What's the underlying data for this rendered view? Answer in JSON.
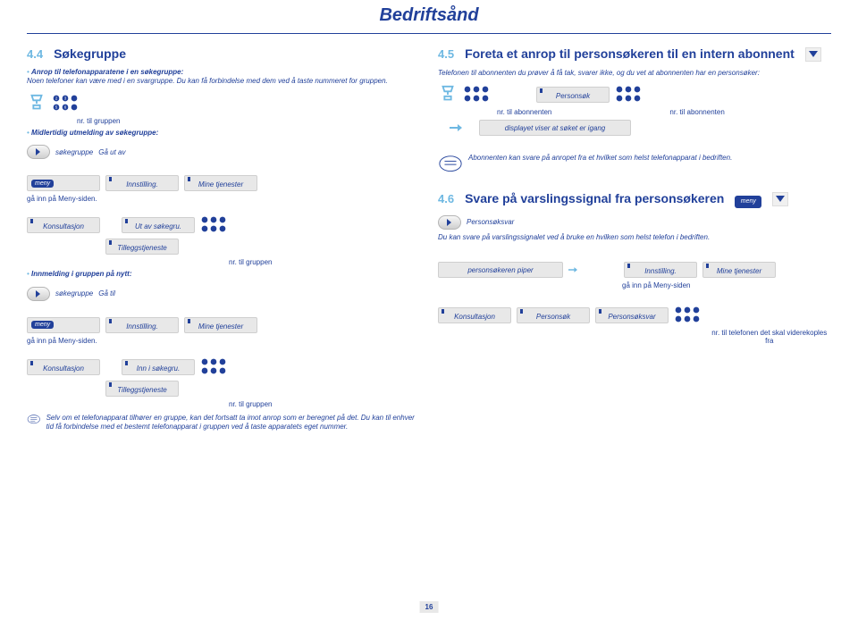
{
  "page": {
    "title": "Bedriftsånd",
    "page_number": "16"
  },
  "left": {
    "s44": {
      "num": "4.4",
      "title": "Søkegruppe",
      "intro_1": "Anrop til telefonapparatene i en søkegruppe:",
      "intro_2": "Noen telefoner kan være med i en svargruppe. Du kan få forbindelse med dem ved å taste nummeret for gruppen.",
      "label_nr_gruppen": "nr. til gruppen",
      "sub1": "Midlertidig utmelding av søkegruppe:",
      "lcd_sokegruppe": "søkegruppe",
      "lcd_ga_ut_av": "Gå ut av",
      "meny_label": "meny",
      "lcd_innstilling": "Innstilling.",
      "lcd_mine_tj": "Mine tjenester",
      "meny_note": "gå inn på Meny-siden.",
      "lcd_konsultasjon": "Konsultasjon",
      "lcd_tillegg": "Tilleggstjeneste",
      "lcd_ut_av": "Ut av søkegru.",
      "sub2": "Innmelding i gruppen på nytt:",
      "lcd_ga_til": "Gå til",
      "lcd_inn_i": "Inn i søkegru.",
      "note_text": "Selv om et telefonapparat tilhører en gruppe, kan det fortsatt ta imot anrop som er beregnet på det. Du kan til enhver tid få forbindelse med et bestemt telefonapparat i gruppen ved å taste apparatets eget nummer."
    }
  },
  "right": {
    "s45": {
      "num": "4.5",
      "title": "Foreta et anrop til personsøkeren til en intern abonnent",
      "intro": "Telefonen til abonnenten du prøver å få tak, svarer ikke, og du vet at abonnenten har en personsøker:",
      "lcd_personsok": "Personsøk",
      "label_nr_abon": "nr. til abonnenten",
      "lcd_display": "displayet viser at søket er igang",
      "note_text": "Abonnenten kan svare på anropet fra et hvilket som helst telefonapparat i bedriften."
    },
    "s46": {
      "num": "4.6",
      "title": "Svare på varslingssignal fra personsøkeren",
      "meny_label": "meny",
      "lcd_personsoksvar": "Personsøksvar",
      "body": "Du kan svare på varslingssignalet ved å bruke en hvilken som helst telefon i bedriften.",
      "lcd_piper": "personsøkeren piper",
      "meny_note": "gå inn på Meny-siden",
      "lcd_innstilling": "Innstilling.",
      "lcd_mine_tj": "Mine tjenester",
      "lcd_konsultasjon": "Konsultasjon",
      "lcd_personsok": "Personsøk",
      "label_nr_tel": "nr. til telefonen det skal viderekoples fra"
    }
  }
}
